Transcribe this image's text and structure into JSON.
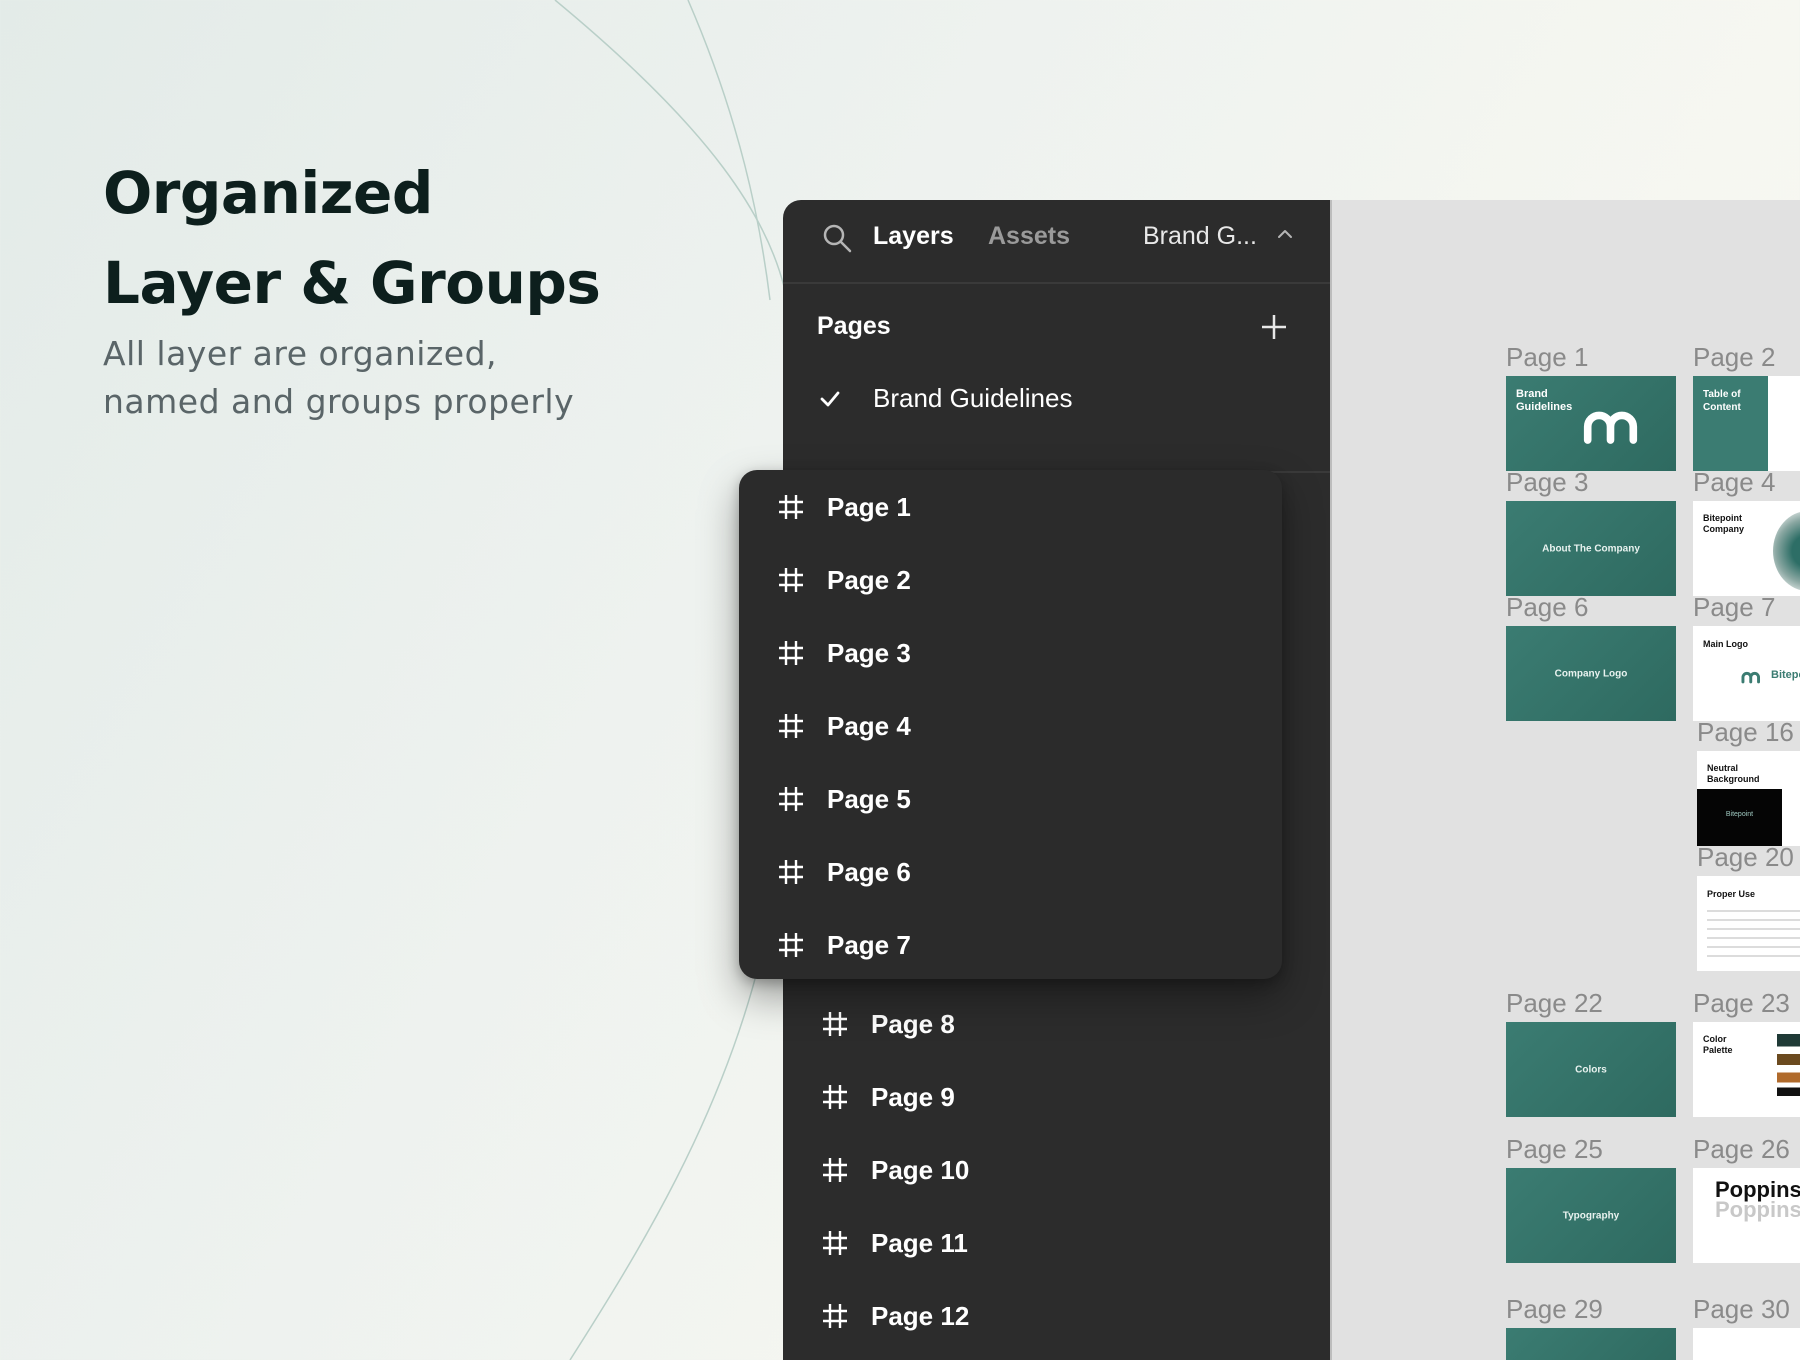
{
  "hero": {
    "title_line1": "Organized",
    "title_line2": "Layer & Groups",
    "subtitle_line1": "All layer are organized,",
    "subtitle_line2": "named and groups properly"
  },
  "panel": {
    "tabs": {
      "layers": "Layers",
      "assets": "Assets"
    },
    "page_select": "Brand G...",
    "pages_label": "Pages",
    "current_page": "Brand Guidelines",
    "drag_items": [
      "Page 1",
      "Page 2",
      "Page 3",
      "Page 4",
      "Page 5",
      "Page 6",
      "Page 7"
    ],
    "items": [
      "Page 8",
      "Page 9",
      "Page 10",
      "Page 11",
      "Page 12"
    ]
  },
  "canvas": {
    "frames": {
      "p1": {
        "label": "Page 1",
        "title": "Brand\nGuidelines"
      },
      "p2": {
        "label": "Page 2",
        "title": "Table of\nContent"
      },
      "p3": {
        "label": "Page 3",
        "title": "About The Company"
      },
      "p4": {
        "label": "Page 4",
        "title": "Bitepoint\nCompany"
      },
      "p6": {
        "label": "Page 6",
        "title": "Company Logo"
      },
      "p7": {
        "label": "Page 7",
        "title": "Main Logo",
        "logo_text": "Bitepo"
      },
      "p16": {
        "label": "Page 16",
        "title": "Neutral\nBackground",
        "logo_text": "Bitepoint"
      },
      "p20": {
        "label": "Page 20",
        "title": "Proper Use"
      },
      "p22": {
        "label": "Page 22",
        "title": "Colors"
      },
      "p23": {
        "label": "Page 23",
        "title": "Color\nPalette"
      },
      "p25": {
        "label": "Page 25",
        "title": "Typography"
      },
      "p26": {
        "label": "Page 26",
        "title": "Poppins I",
        "ghost": "Poppins"
      },
      "p29": {
        "label": "Page 29"
      },
      "p30": {
        "label": "Page 30"
      }
    }
  },
  "colors": {
    "panel_bg": "#2c2c2c",
    "brand_green": "#3b7c72",
    "canvas_bg": "#e1e1e1",
    "heading": "#0d1f1d"
  }
}
